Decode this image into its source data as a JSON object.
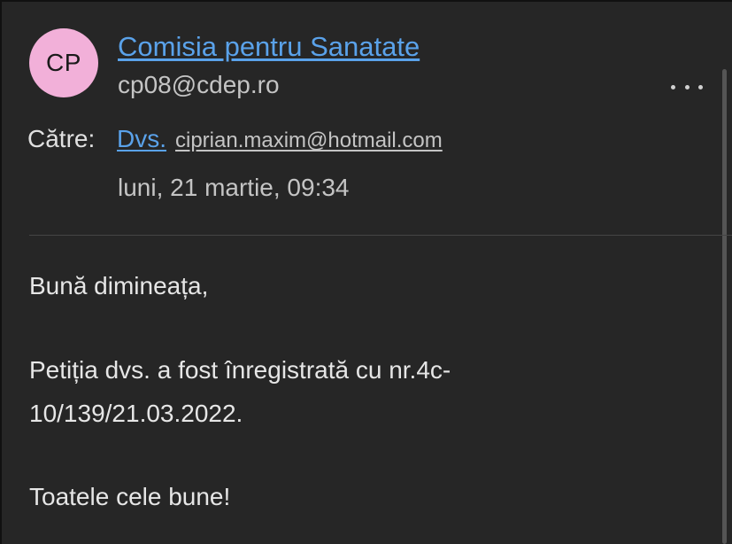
{
  "sender": {
    "initials": "CP",
    "name": "Comisia pentru Sanatate",
    "email": "cp08@cdep.ro"
  },
  "recipients": {
    "label": "Către:",
    "name": "Dvs.",
    "email": " ciprian.maxim@hotmail.com"
  },
  "date": "luni, 21 martie, 09:34",
  "message": {
    "greeting": "Bună dimineața,",
    "line1": "Petiția dvs. a fost înregistrată cu nr.4c-",
    "line2": "10/139/21.03.2022.",
    "closing": "Toatele cele bune!"
  },
  "icons": {
    "more": "more-options-icon"
  },
  "colors": {
    "background": "#262626",
    "link": "#5aa2ea",
    "avatar": "#f2b0d9"
  }
}
